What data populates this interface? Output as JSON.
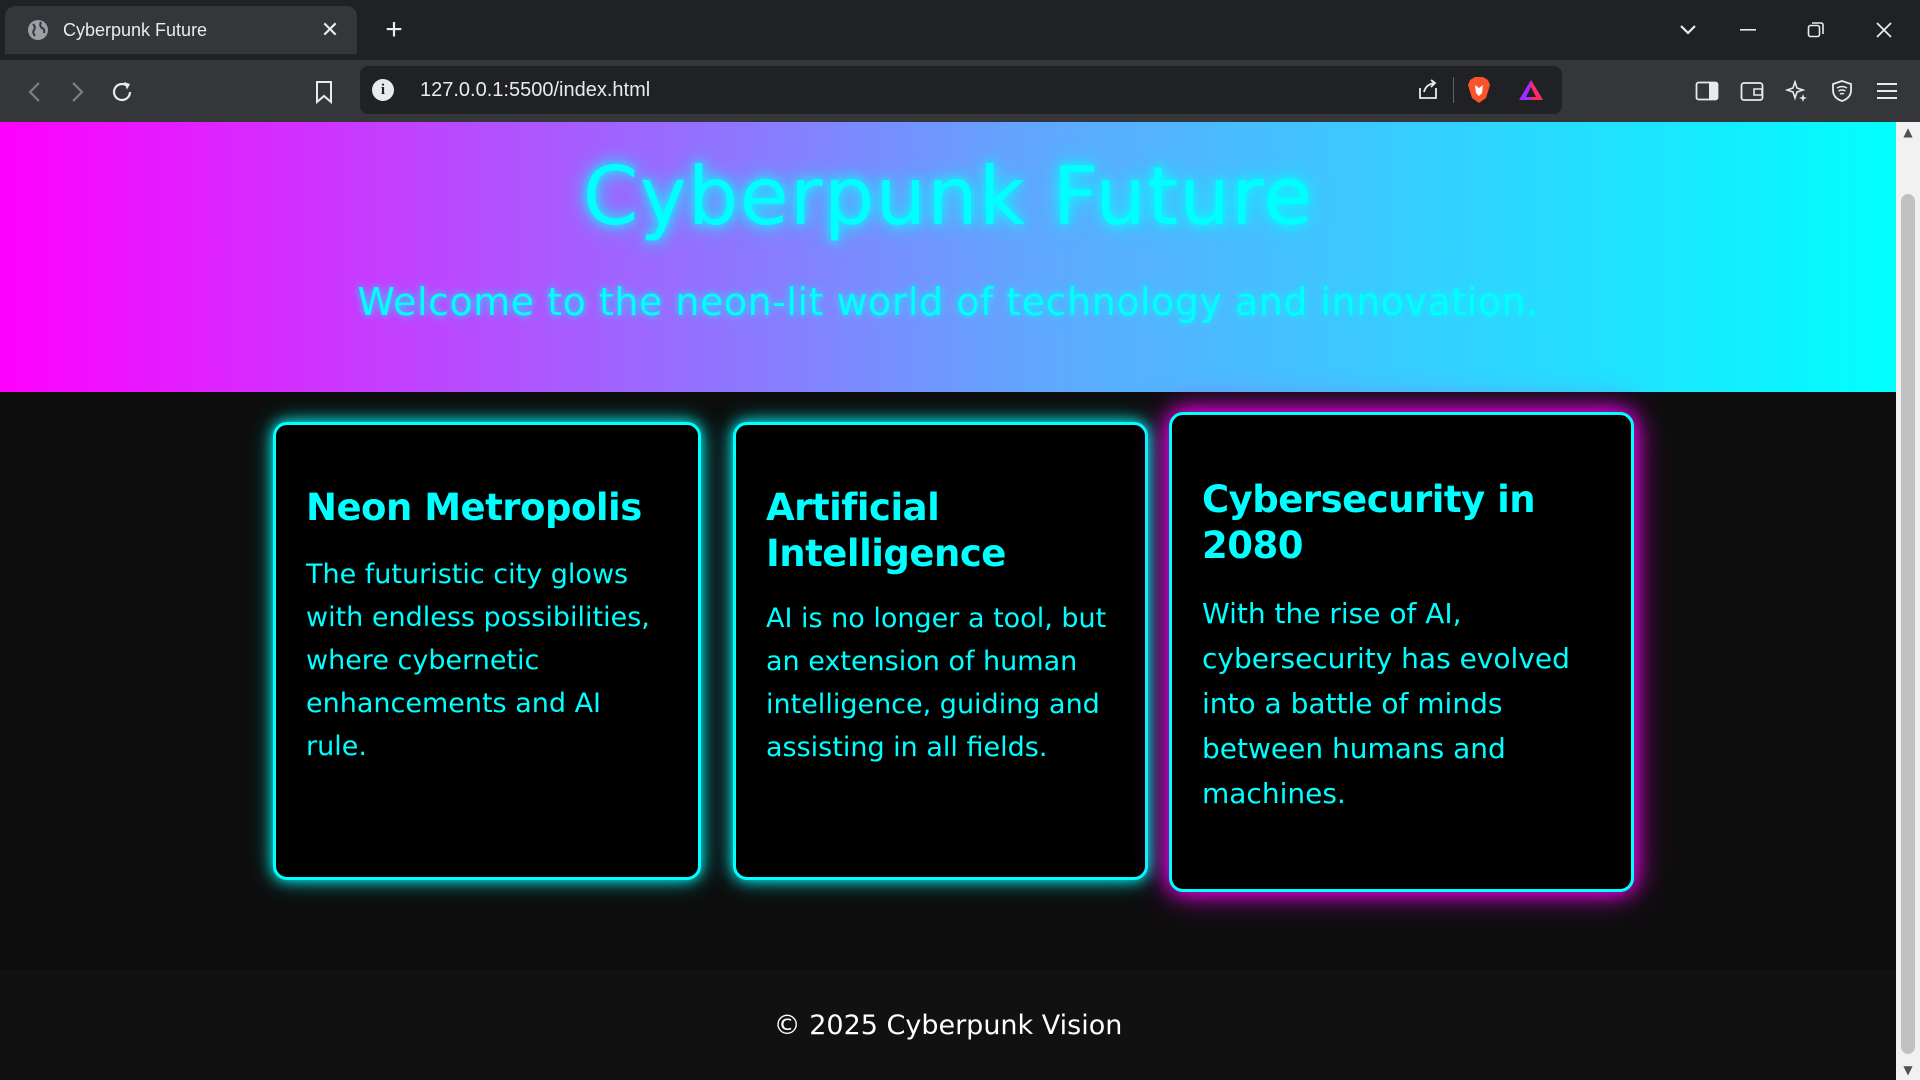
{
  "browser": {
    "tab_title": "Cyberpunk Future",
    "tab_close": "✕",
    "new_tab": "+",
    "url": "127.0.0.1:5500/index.html"
  },
  "page": {
    "hero": {
      "title": "Cyberpunk Future",
      "subtitle": "Welcome to the neon-lit world of technology and innovation."
    },
    "cards": [
      {
        "title": "Neon Metropolis",
        "body": "The futuristic city glows with endless possibilities, where cybernetic enhancements and AI rule."
      },
      {
        "title": "Artificial Intelligence",
        "body": "AI is no longer a tool, but an extension of human intelligence, guiding and assisting in all fields."
      },
      {
        "title": "Cybersecurity in 2080",
        "body": "With the rise of AI, cybersecurity has evolved into a battle of minds between humans and machines."
      }
    ],
    "footer": "© 2025 Cyberpunk Vision"
  },
  "colors": {
    "neon_cyan": "#00ffff",
    "neon_magenta": "#ff00ff",
    "card_bg": "#000000",
    "page_bg": "#0d0d0d"
  }
}
